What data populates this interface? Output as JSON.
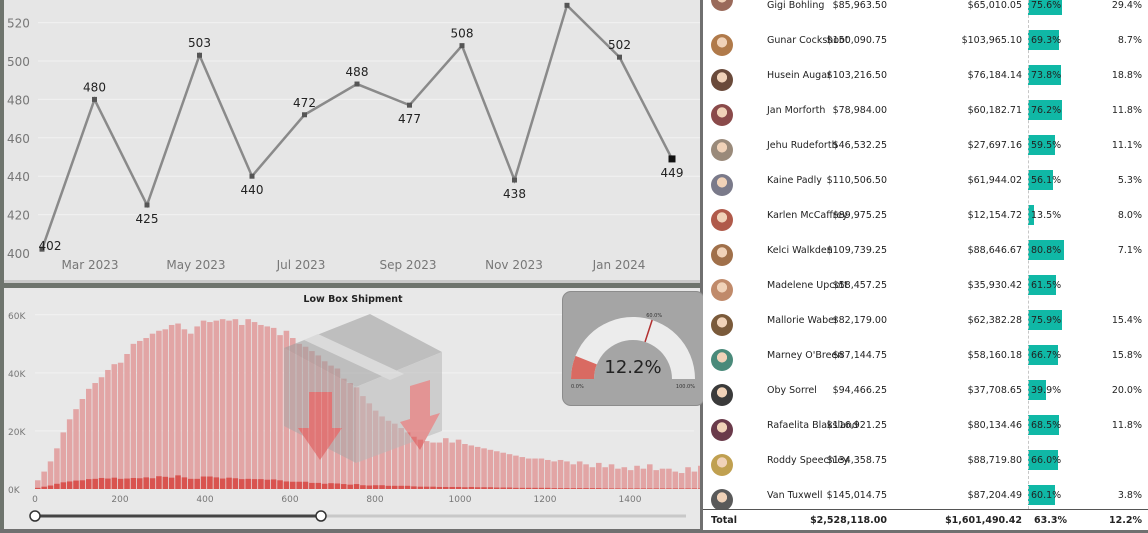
{
  "line_chart": {
    "y_ticks": [
      "520",
      "500",
      "480",
      "460",
      "440",
      "420",
      "400"
    ],
    "x_ticks": [
      "Mar 2023",
      "May 2023",
      "Jul 2023",
      "Sep 2023",
      "Nov 2023",
      "Jan 2024"
    ]
  },
  "chart_data": [
    {
      "type": "line",
      "ylim": [
        400,
        530
      ],
      "x": [
        "2022-12",
        "2023-01",
        "2023-02",
        "2023-03",
        "2023-04",
        "2023-05",
        "2023-06",
        "2023-07",
        "2023-08",
        "2023-09",
        "2023-10",
        "2023-11",
        "2023-12",
        "2024-01",
        "2024-02"
      ],
      "values": [
        402,
        480,
        425,
        503,
        440,
        472,
        488,
        477,
        508,
        438,
        529,
        502,
        449
      ],
      "series": [
        {
          "x": [
            "2023-02",
            "2023-03",
            "2023-04",
            "2023-05",
            "2023-06",
            "2023-07",
            "2023-08",
            "2023-09",
            "2023-10",
            "2023-11",
            "2023-12",
            "2024-01",
            "2024-02"
          ],
          "values": [
            402,
            480,
            425,
            503,
            440,
            472,
            488,
            477,
            508,
            438,
            529,
            502,
            449
          ],
          "labels": [
            "402",
            "480",
            "425",
            "503",
            "440",
            "472",
            "488",
            "477",
            "508",
            "438",
            "",
            "502",
            "449"
          ]
        }
      ]
    },
    {
      "type": "bar",
      "title": "Low Box Shipment",
      "xlim": [
        0,
        1550
      ],
      "ylim": [
        0,
        65000
      ],
      "x_ticks": [
        "0",
        "200",
        "400",
        "600",
        "800",
        "1000",
        "1200",
        "1400"
      ],
      "y_ticks": [
        "60K",
        "40K",
        "20K",
        "0K"
      ],
      "series": [
        {
          "values": [
            3000,
            6000,
            9500,
            14000,
            19500,
            24000,
            27500,
            31000,
            34500,
            36500,
            38500,
            41000,
            43000,
            43500,
            46500,
            50000,
            51000,
            52000,
            53500,
            54500,
            55000,
            56500,
            57000,
            55000,
            53500,
            56000,
            58000,
            57500,
            58000,
            58500,
            58000,
            58500,
            56500,
            58500,
            57500,
            56500,
            56000,
            55500,
            53000,
            54500,
            52000,
            50000,
            49000,
            47500,
            46000,
            44000,
            42500,
            41500,
            38000,
            36500,
            35000,
            32000,
            29500,
            27000,
            25000,
            23500,
            22500,
            21000,
            19500,
            18000,
            17000,
            16500,
            16000,
            16000,
            17500,
            16000,
            17000,
            15500,
            15000,
            14500,
            14000,
            13500,
            13000,
            12500,
            12000,
            11500,
            11000,
            10500,
            10500,
            10500,
            10000,
            9500,
            10000,
            9500,
            8500,
            9500,
            8500,
            7500,
            9000,
            7500,
            8500,
            7000,
            7500,
            6500,
            8000,
            7000,
            8500,
            6500,
            7000,
            7000,
            6000,
            5500,
            7500,
            6000,
            8000,
            7000,
            6500
          ]
        },
        {
          "values": [
            400,
            800,
            1200,
            1800,
            2300,
            2600,
            2900,
            3000,
            3400,
            3500,
            3800,
            3600,
            3900,
            3500,
            3600,
            3800,
            3700,
            4000,
            3700,
            4400,
            4200,
            3900,
            4700,
            4000,
            3500,
            3500,
            4300,
            4300,
            4000,
            3600,
            3900,
            3700,
            3400,
            3500,
            3400,
            3400,
            3200,
            3300,
            3000,
            2600,
            2500,
            2500,
            2500,
            2100,
            2100,
            1800,
            2000,
            1900,
            1700,
            1500,
            1700,
            1300,
            1200,
            1300,
            1300,
            1100,
            1100,
            1100,
            1100,
            900,
            800,
            800,
            800,
            700,
            700,
            700,
            700,
            600,
            700,
            600,
            600,
            600,
            500,
            500,
            500,
            400,
            400,
            400,
            400,
            400,
            400,
            300,
            300,
            300,
            300,
            300,
            300,
            300,
            300,
            200,
            200,
            200,
            200,
            200,
            200,
            200,
            200,
            200,
            200,
            200,
            200,
            200,
            200,
            200,
            200,
            200,
            200
          ]
        }
      ]
    }
  ],
  "gauge": {
    "value": "12.2%",
    "min": "0.0%",
    "max": "100.0%",
    "target": "60.0%",
    "value_fraction": 0.122,
    "target_fraction": 0.6
  },
  "colors": {
    "teal": "#10b8a6",
    "hist_light": "#e2a5a5",
    "hist_dark": "#d9534f",
    "gauge_fill": "#d96a62",
    "line": "#8a8a8a"
  },
  "table": {
    "rows": [
      {
        "name": "Gigi Bohling",
        "sales": "$85,963.50",
        "profit": "$65,010.05",
        "pct": "75.6%",
        "pct_value": 0.756,
        "last": "29.4%",
        "avatar": "#9a6a5a"
      },
      {
        "name": "Gunar Cockshoot",
        "sales": "$150,090.75",
        "profit": "$103,965.10",
        "pct": "69.3%",
        "pct_value": 0.693,
        "last": "8.7%",
        "avatar": "#b07a4a"
      },
      {
        "name": "Husein Augar",
        "sales": "$103,216.50",
        "profit": "$76,184.14",
        "pct": "73.8%",
        "pct_value": 0.738,
        "last": "18.8%",
        "avatar": "#6a4a3a"
      },
      {
        "name": "Jan Morforth",
        "sales": "$78,984.00",
        "profit": "$60,182.71",
        "pct": "76.2%",
        "pct_value": 0.762,
        "last": "11.8%",
        "avatar": "#8a4a4a"
      },
      {
        "name": "Jehu Rudeforth",
        "sales": "$46,532.25",
        "profit": "$27,697.16",
        "pct": "59.5%",
        "pct_value": 0.595,
        "last": "11.1%",
        "avatar": "#9a8a7a"
      },
      {
        "name": "Kaine Padly",
        "sales": "$110,506.50",
        "profit": "$61,944.02",
        "pct": "56.1%",
        "pct_value": 0.561,
        "last": "5.3%",
        "avatar": "#7a7a8a"
      },
      {
        "name": "Karlen McCaffrey",
        "sales": "$89,975.25",
        "profit": "$12,154.72",
        "pct": "13.5%",
        "pct_value": 0.135,
        "last": "8.0%",
        "avatar": "#b05a4a"
      },
      {
        "name": "Kelci Walkden",
        "sales": "$109,739.25",
        "profit": "$88,646.67",
        "pct": "80.8%",
        "pct_value": 0.808,
        "last": "7.1%",
        "avatar": "#a0704a"
      },
      {
        "name": "Madelene Upcott",
        "sales": "$58,457.25",
        "profit": "$35,930.42",
        "pct": "61.5%",
        "pct_value": 0.615,
        "last": "",
        "avatar": "#c08a6a"
      },
      {
        "name": "Mallorie Waber",
        "sales": "$82,179.00",
        "profit": "$62,382.28",
        "pct": "75.9%",
        "pct_value": 0.759,
        "last": "15.4%",
        "avatar": "#7a5a3a"
      },
      {
        "name": "Marney O'Breen",
        "sales": "$87,144.75",
        "profit": "$58,160.18",
        "pct": "66.7%",
        "pct_value": 0.667,
        "last": "15.8%",
        "avatar": "#4a8a7a"
      },
      {
        "name": "Oby Sorrel",
        "sales": "$94,466.25",
        "profit": "$37,708.65",
        "pct": "39.9%",
        "pct_value": 0.399,
        "last": "20.0%",
        "avatar": "#3a3a3a"
      },
      {
        "name": "Rafaelita Blaksland",
        "sales": "$116,921.25",
        "profit": "$80,134.46",
        "pct": "68.5%",
        "pct_value": 0.685,
        "last": "11.8%",
        "avatar": "#6a3a4a"
      },
      {
        "name": "Roddy Speechley",
        "sales": "$134,358.75",
        "profit": "$88,719.80",
        "pct": "66.0%",
        "pct_value": 0.66,
        "last": "",
        "avatar": "#c0a050"
      },
      {
        "name": "Van Tuxwell",
        "sales": "$145,014.75",
        "profit": "$87,204.49",
        "pct": "60.1%",
        "pct_value": 0.601,
        "last": "3.8%",
        "avatar": "#5a5a5a"
      }
    ],
    "total": {
      "label": "Total",
      "sales": "$2,528,118.00",
      "profit": "$1,601,490.42",
      "pct": "63.3%",
      "last": "12.2%"
    }
  }
}
